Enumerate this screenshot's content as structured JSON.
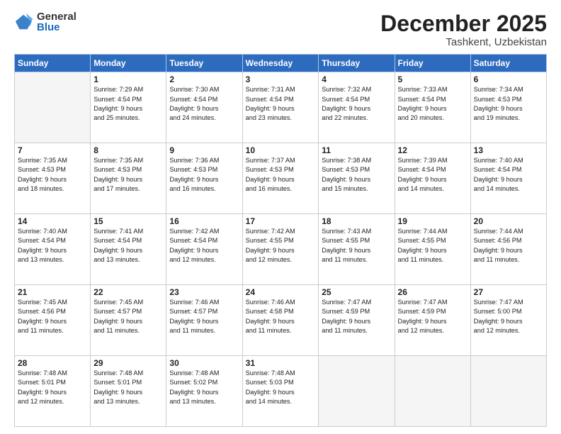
{
  "logo": {
    "general": "General",
    "blue": "Blue"
  },
  "header": {
    "month": "December 2025",
    "location": "Tashkent, Uzbekistan"
  },
  "days_of_week": [
    "Sunday",
    "Monday",
    "Tuesday",
    "Wednesday",
    "Thursday",
    "Friday",
    "Saturday"
  ],
  "weeks": [
    [
      {
        "day": "",
        "info": ""
      },
      {
        "day": "1",
        "info": "Sunrise: 7:29 AM\nSunset: 4:54 PM\nDaylight: 9 hours\nand 25 minutes."
      },
      {
        "day": "2",
        "info": "Sunrise: 7:30 AM\nSunset: 4:54 PM\nDaylight: 9 hours\nand 24 minutes."
      },
      {
        "day": "3",
        "info": "Sunrise: 7:31 AM\nSunset: 4:54 PM\nDaylight: 9 hours\nand 23 minutes."
      },
      {
        "day": "4",
        "info": "Sunrise: 7:32 AM\nSunset: 4:54 PM\nDaylight: 9 hours\nand 22 minutes."
      },
      {
        "day": "5",
        "info": "Sunrise: 7:33 AM\nSunset: 4:54 PM\nDaylight: 9 hours\nand 20 minutes."
      },
      {
        "day": "6",
        "info": "Sunrise: 7:34 AM\nSunset: 4:53 PM\nDaylight: 9 hours\nand 19 minutes."
      }
    ],
    [
      {
        "day": "7",
        "info": "Sunrise: 7:35 AM\nSunset: 4:53 PM\nDaylight: 9 hours\nand 18 minutes."
      },
      {
        "day": "8",
        "info": "Sunrise: 7:35 AM\nSunset: 4:53 PM\nDaylight: 9 hours\nand 17 minutes."
      },
      {
        "day": "9",
        "info": "Sunrise: 7:36 AM\nSunset: 4:53 PM\nDaylight: 9 hours\nand 16 minutes."
      },
      {
        "day": "10",
        "info": "Sunrise: 7:37 AM\nSunset: 4:53 PM\nDaylight: 9 hours\nand 16 minutes."
      },
      {
        "day": "11",
        "info": "Sunrise: 7:38 AM\nSunset: 4:53 PM\nDaylight: 9 hours\nand 15 minutes."
      },
      {
        "day": "12",
        "info": "Sunrise: 7:39 AM\nSunset: 4:54 PM\nDaylight: 9 hours\nand 14 minutes."
      },
      {
        "day": "13",
        "info": "Sunrise: 7:40 AM\nSunset: 4:54 PM\nDaylight: 9 hours\nand 14 minutes."
      }
    ],
    [
      {
        "day": "14",
        "info": "Sunrise: 7:40 AM\nSunset: 4:54 PM\nDaylight: 9 hours\nand 13 minutes."
      },
      {
        "day": "15",
        "info": "Sunrise: 7:41 AM\nSunset: 4:54 PM\nDaylight: 9 hours\nand 13 minutes."
      },
      {
        "day": "16",
        "info": "Sunrise: 7:42 AM\nSunset: 4:54 PM\nDaylight: 9 hours\nand 12 minutes."
      },
      {
        "day": "17",
        "info": "Sunrise: 7:42 AM\nSunset: 4:55 PM\nDaylight: 9 hours\nand 12 minutes."
      },
      {
        "day": "18",
        "info": "Sunrise: 7:43 AM\nSunset: 4:55 PM\nDaylight: 9 hours\nand 11 minutes."
      },
      {
        "day": "19",
        "info": "Sunrise: 7:44 AM\nSunset: 4:55 PM\nDaylight: 9 hours\nand 11 minutes."
      },
      {
        "day": "20",
        "info": "Sunrise: 7:44 AM\nSunset: 4:56 PM\nDaylight: 9 hours\nand 11 minutes."
      }
    ],
    [
      {
        "day": "21",
        "info": "Sunrise: 7:45 AM\nSunset: 4:56 PM\nDaylight: 9 hours\nand 11 minutes."
      },
      {
        "day": "22",
        "info": "Sunrise: 7:45 AM\nSunset: 4:57 PM\nDaylight: 9 hours\nand 11 minutes."
      },
      {
        "day": "23",
        "info": "Sunrise: 7:46 AM\nSunset: 4:57 PM\nDaylight: 9 hours\nand 11 minutes."
      },
      {
        "day": "24",
        "info": "Sunrise: 7:46 AM\nSunset: 4:58 PM\nDaylight: 9 hours\nand 11 minutes."
      },
      {
        "day": "25",
        "info": "Sunrise: 7:47 AM\nSunset: 4:59 PM\nDaylight: 9 hours\nand 11 minutes."
      },
      {
        "day": "26",
        "info": "Sunrise: 7:47 AM\nSunset: 4:59 PM\nDaylight: 9 hours\nand 12 minutes."
      },
      {
        "day": "27",
        "info": "Sunrise: 7:47 AM\nSunset: 5:00 PM\nDaylight: 9 hours\nand 12 minutes."
      }
    ],
    [
      {
        "day": "28",
        "info": "Sunrise: 7:48 AM\nSunset: 5:01 PM\nDaylight: 9 hours\nand 12 minutes."
      },
      {
        "day": "29",
        "info": "Sunrise: 7:48 AM\nSunset: 5:01 PM\nDaylight: 9 hours\nand 13 minutes."
      },
      {
        "day": "30",
        "info": "Sunrise: 7:48 AM\nSunset: 5:02 PM\nDaylight: 9 hours\nand 13 minutes."
      },
      {
        "day": "31",
        "info": "Sunrise: 7:48 AM\nSunset: 5:03 PM\nDaylight: 9 hours\nand 14 minutes."
      },
      {
        "day": "",
        "info": ""
      },
      {
        "day": "",
        "info": ""
      },
      {
        "day": "",
        "info": ""
      }
    ]
  ]
}
